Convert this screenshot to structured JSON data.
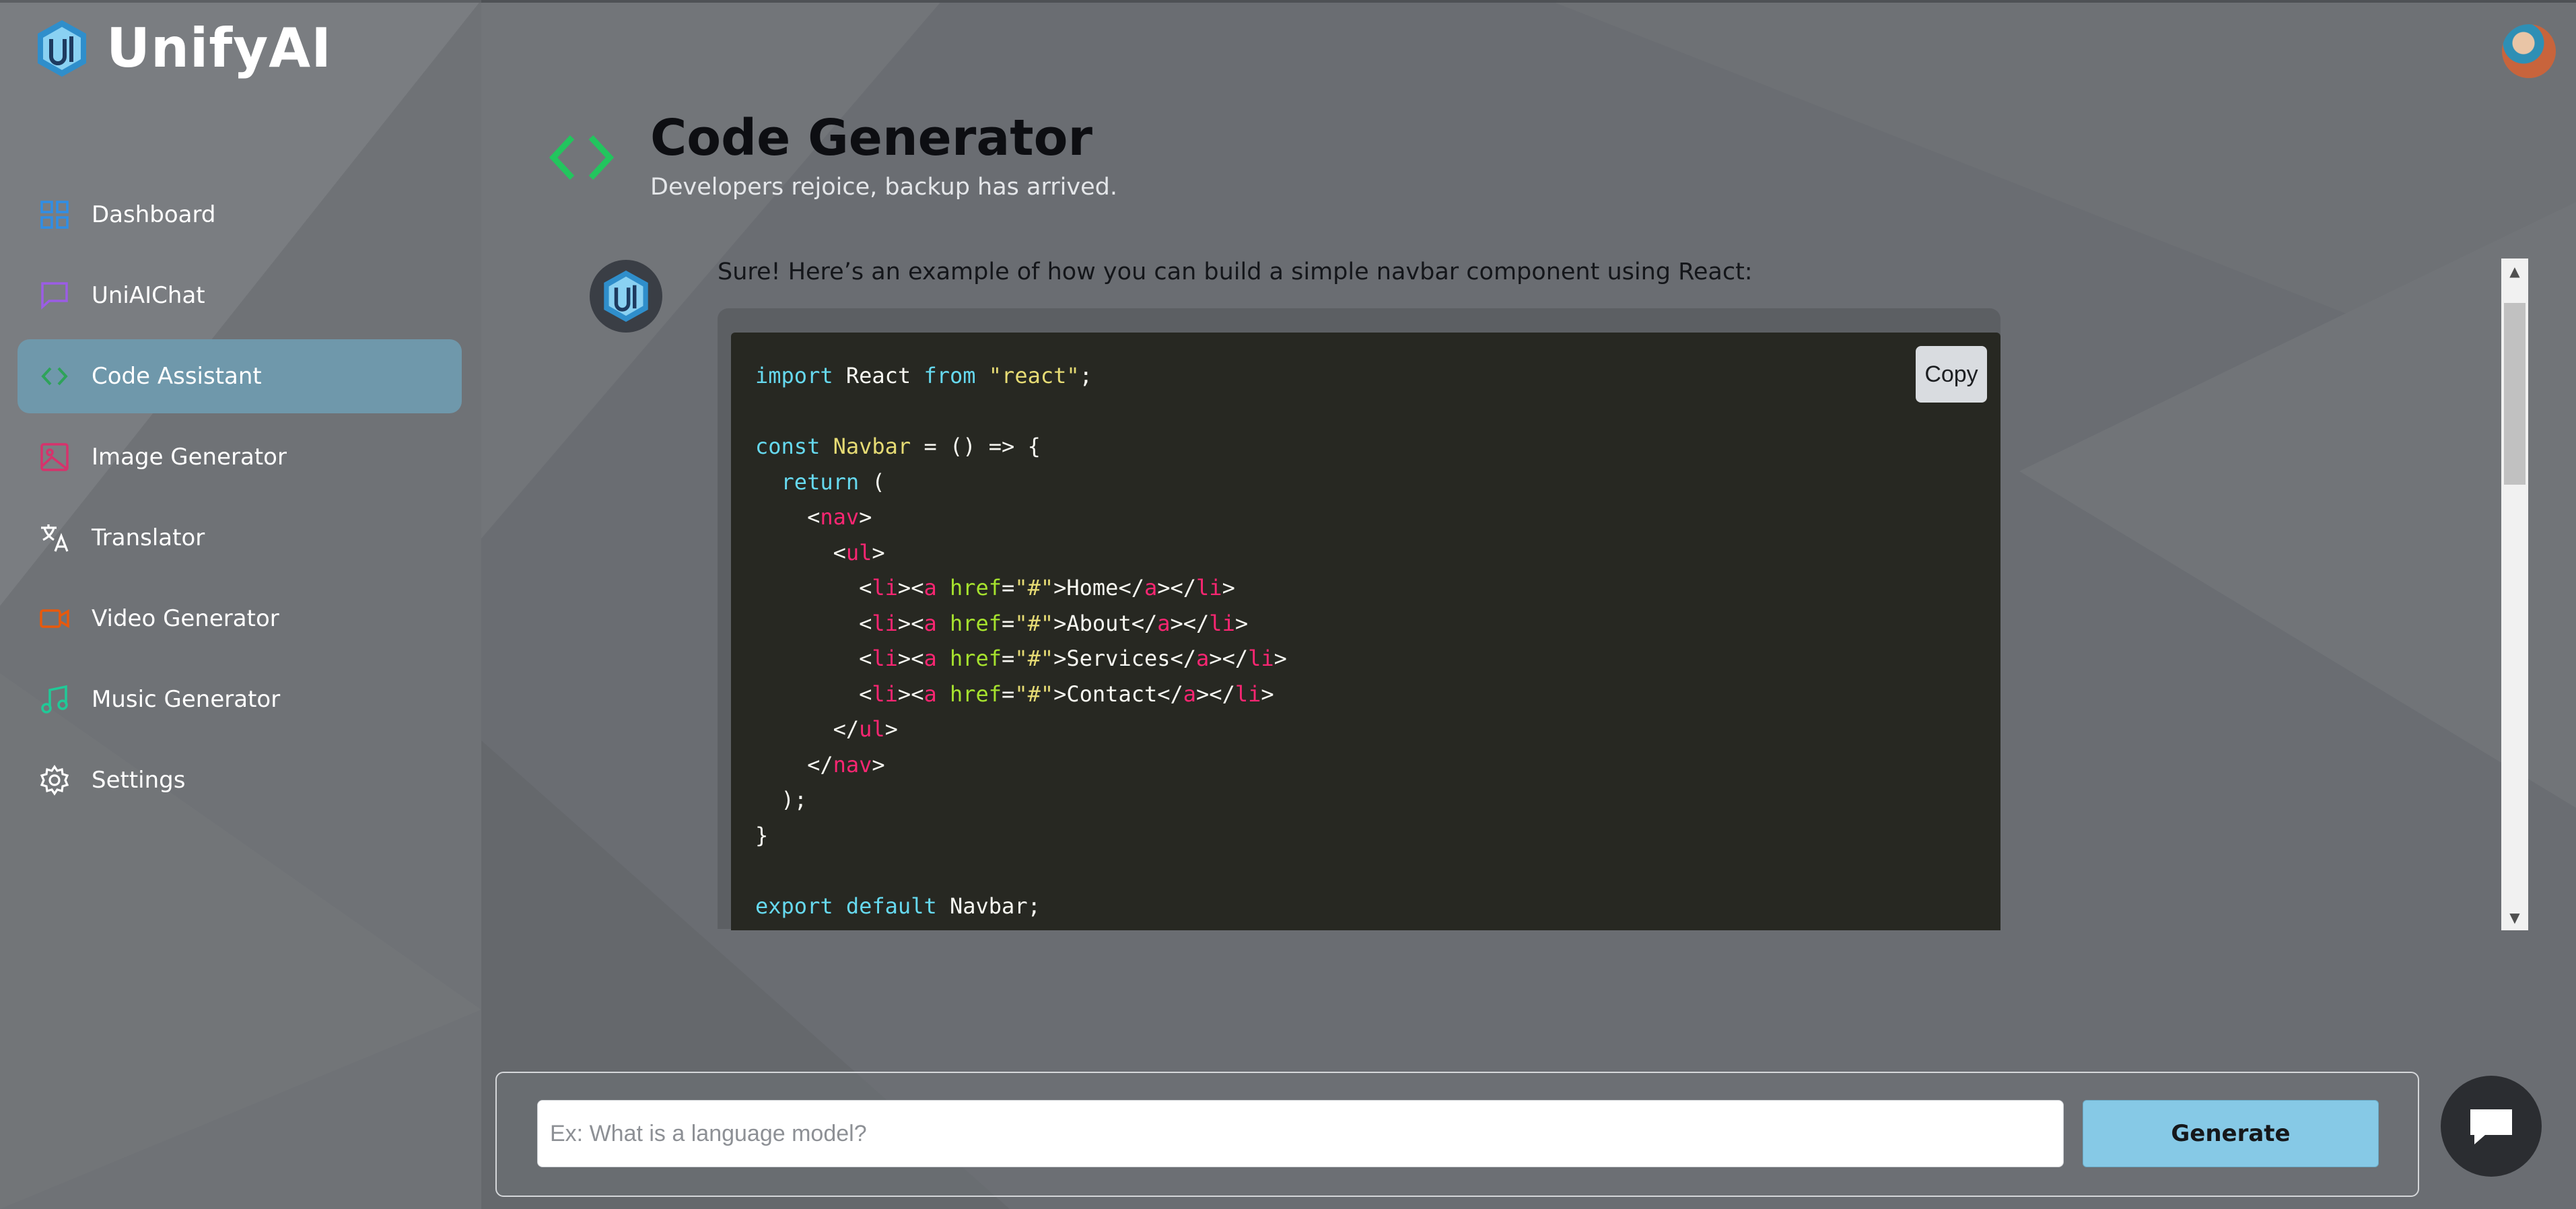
{
  "app": {
    "name": "UnifyAI"
  },
  "sidebar": {
    "items": [
      {
        "label": "Dashboard",
        "icon": "dashboard-icon",
        "color": "#2f8ee6",
        "active": false
      },
      {
        "label": "UniAIChat",
        "icon": "chat-icon",
        "color": "#9b5de5",
        "active": false
      },
      {
        "label": "Code Assistant",
        "icon": "code-icon",
        "color": "#2ea35a",
        "active": true
      },
      {
        "label": "Image Generator",
        "icon": "image-icon",
        "color": "#d6336c",
        "active": false
      },
      {
        "label": "Translator",
        "icon": "translate-icon",
        "color": "#ffffff",
        "active": false
      },
      {
        "label": "Video Generator",
        "icon": "video-icon",
        "color": "#e8590c",
        "active": false
      },
      {
        "label": "Music Generator",
        "icon": "music-icon",
        "color": "#20c997",
        "active": false
      },
      {
        "label": "Settings",
        "icon": "settings-icon",
        "color": "#ffffff",
        "active": false
      }
    ]
  },
  "page": {
    "title": "Code Generator",
    "subtitle": "Developers rejoice, backup has arrived.",
    "accent": "#22c55e"
  },
  "conversation": {
    "bot_message": "Sure! Here’s an example of how you can build a simple navbar component using React:",
    "copy_label": "Copy"
  },
  "prompt": {
    "placeholder": "Ex: What is a language model?",
    "value": "",
    "generate_label": "Generate"
  }
}
